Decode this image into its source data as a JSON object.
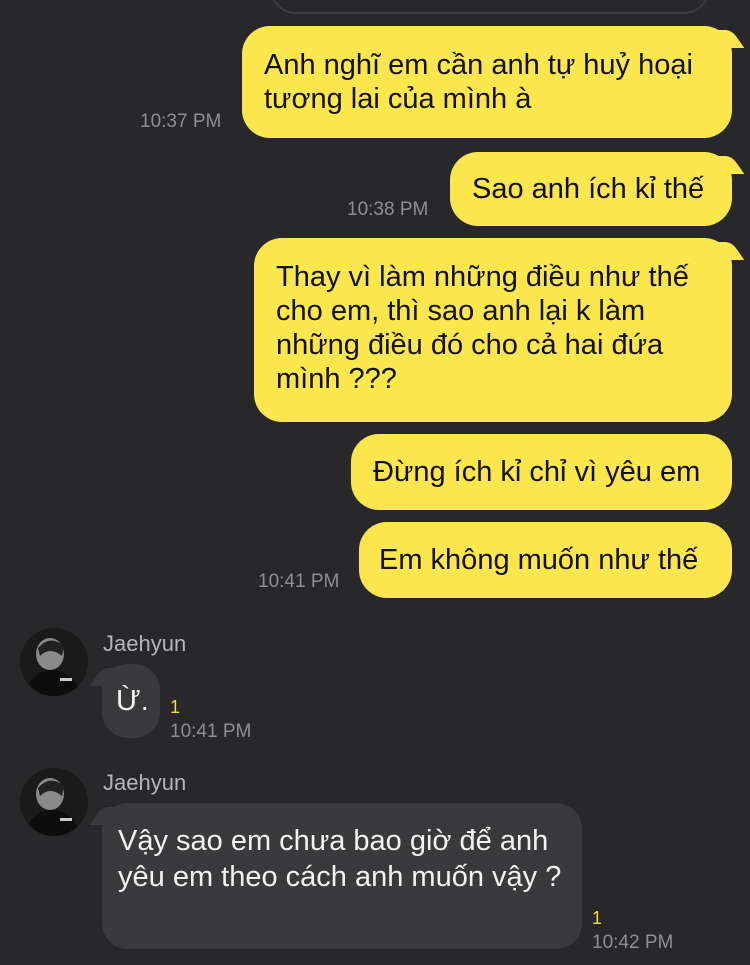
{
  "outgoing": [
    {
      "text": "Anh nghĩ em cần anh tự huỷ hoại tương lai của mình à",
      "time": "10:37 PM"
    },
    {
      "text": "Sao anh ích kỉ thế",
      "time": "10:38 PM"
    },
    {
      "text": "Thay vì làm những điều như thế cho em, thì sao anh lại k làm những điều đó cho cả hai đứa mình ???",
      "time": ""
    },
    {
      "text": "Đừng ích kỉ chỉ vì yêu em",
      "time": ""
    },
    {
      "text": "Em không muốn như thế",
      "time": "10:41 PM"
    }
  ],
  "incoming": [
    {
      "sender": "Jaehyun",
      "text": "Ừ.",
      "unread": "1",
      "time": "10:41 PM"
    },
    {
      "sender": "Jaehyun",
      "text": "Vậy sao em chưa bao giờ để anh yêu em theo cách anh muốn vậy ?",
      "unread": "1",
      "time": "10:42 PM"
    }
  ],
  "colors": {
    "background": "#28282a",
    "outgoing_bubble": "#fbe64d",
    "incoming_bubble": "#3a3a3c",
    "unread_count": "#f5dc3c",
    "timestamp": "#8e8e93"
  }
}
